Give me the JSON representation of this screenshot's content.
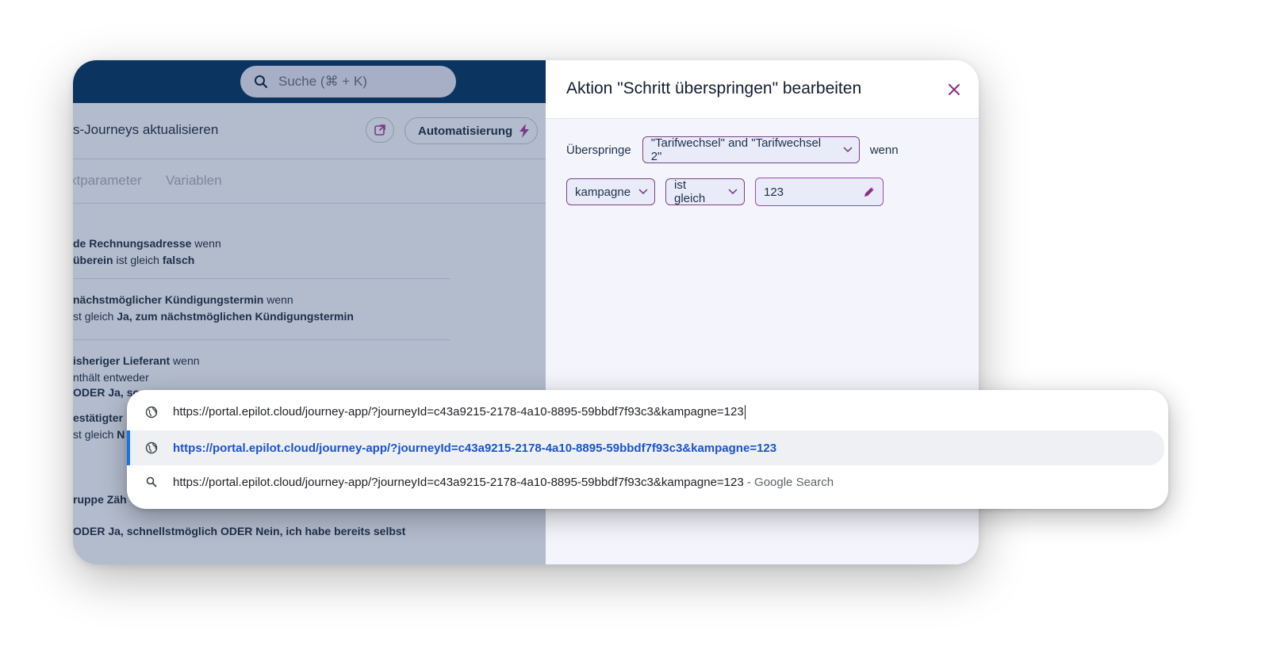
{
  "app": {
    "search_placeholder": "Suche (⌘ + K)",
    "page_title": "s-Journeys aktualisieren",
    "automation_label": "Automatisierung",
    "tabs": [
      "xtparameter",
      "Variablen"
    ],
    "rules": [
      {
        "line1_bold": "de Rechnungsadresse",
        "line1_rest": " wenn",
        "line2_bold": "überein",
        "line2_mid": " ist gleich ",
        "line2_bold2": "falsch"
      },
      {
        "line1_bold": "nächstmöglicher Kündigungstermin",
        "line1_rest": " wenn",
        "line2_pre": "st gleich ",
        "line2_bold": "Ja, zum nächstmöglichen Kündigungstermin"
      },
      {
        "line1_bold": "isheriger Lieferant",
        "line1_rest": " wenn",
        "line2_pre": "nthält entweder",
        "line3_bold": "ODER Ja, sc"
      },
      {
        "line1_bold": "estätigter",
        "line2_pre": "st gleich ",
        "line2_bold": "N"
      }
    ],
    "group_line": "ruppe Zäh",
    "bottom_line": "ODER Ja, schnellstmöglich ODER Nein, ich habe bereits selbst"
  },
  "panel": {
    "title": "Aktion \"Schritt überspringen\" bearbeiten",
    "skip_label": "Überspringe",
    "steps_value": "\"Tarifwechsel\" and \"Tarifwechsel 2\"",
    "when_label": "wenn",
    "field_value": "kampagne",
    "operator_value": "ist gleich",
    "compare_value": "123"
  },
  "omnibox": {
    "typed": "https://portal.epilot.cloud/journey-app/?journeyId=c43a9215-2178-4a10-8895-59bbdf7f93c3&kampagne=123",
    "suggestion_url": "https://portal.epilot.cloud/journey-app/?journeyId=c43a9215-2178-4a10-8895-59bbdf7f93c3&kampagne=123",
    "search_query": "https://portal.epilot.cloud/journey-app/?journeyId=c43a9215-2178-4a10-8895-59bbdf7f93c3&kampagne=123",
    "search_suffix": " - Google Search"
  },
  "colors": {
    "navy": "#0b3460",
    "accent_purple": "#7b3f86",
    "link_blue": "#1a53c9"
  }
}
